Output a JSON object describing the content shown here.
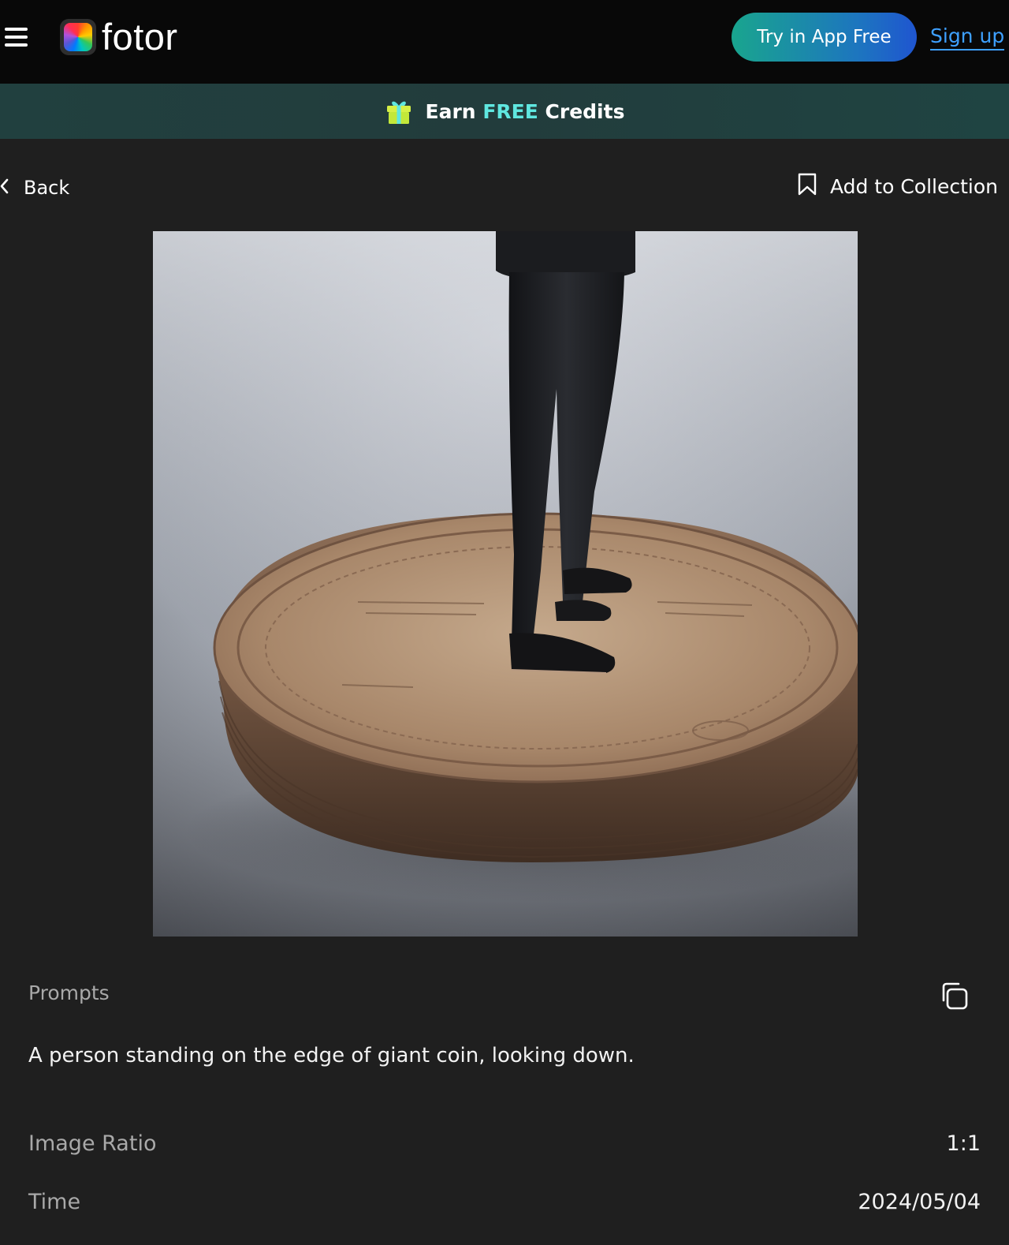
{
  "header": {
    "brand": "fotor",
    "try_app_label": "Try in App Free",
    "signup_label": "Sign up"
  },
  "banner": {
    "prefix": "Earn",
    "highlight": "FREE",
    "suffix": "Credits",
    "highlight_color": "#5fe7e0"
  },
  "nav": {
    "back_label": "Back",
    "collection_label": "Add to Collection"
  },
  "artwork": {
    "description": "A person standing on the edge of giant coin, looking down."
  },
  "details": {
    "prompts_label": "Prompts",
    "prompt_text": "A person standing on the edge of giant coin, looking down.",
    "ratio_label": "Image Ratio",
    "ratio_value": "1:1",
    "time_label": "Time",
    "time_value": "2024/05/04"
  },
  "icons": [
    "menu-icon",
    "fotor-logo-icon",
    "gift-icon",
    "chevron-left-icon",
    "bookmark-icon",
    "copy-icon"
  ],
  "colors": {
    "accent_blue": "#3ea0ff",
    "button_gradient_start": "#19a58e",
    "button_gradient_end": "#1f55d0",
    "background": "#1f1f1f"
  }
}
